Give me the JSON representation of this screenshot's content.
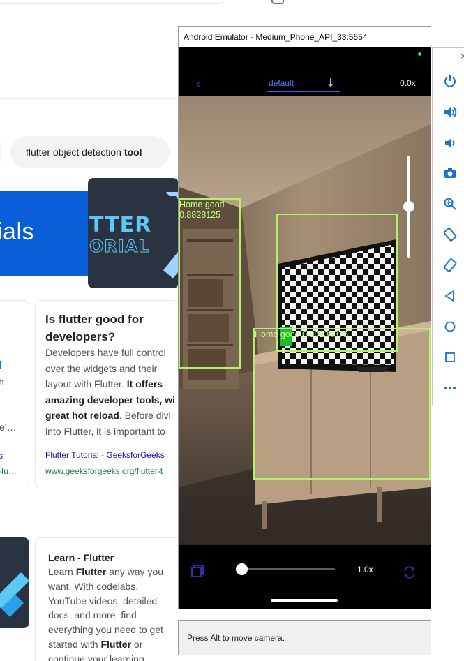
{
  "browser": {
    "search_chip": {
      "prefix": "flutter object detection ",
      "bold": "tool"
    },
    "banner": {
      "left_text": "ials",
      "logo_line1": "TTER",
      "logo_line2": "ORIAL"
    },
    "left_card_fragments": [
      "h",
      "le'…",
      "s",
      "-tu…"
    ],
    "result_card": {
      "title_line1": "Is flutter good for",
      "title_line2": "developers?",
      "line1": "Developers have full control",
      "line2": "over the widgets and their",
      "line3": "layout with Flutter.",
      "line3_bold": " It offers",
      "line4_bold": "amazing developer tools, wi",
      "line5_bold": "great hot reload",
      "line5": ". Before divi",
      "line6": "into Flutter, it is important to",
      "source": "Flutter Tutorial - GeeksforGeeks",
      "url": "www.geeksforgeeks.org/flutter-t"
    },
    "learn_card": {
      "title": "Learn - Flutter",
      "l1a": "Learn ",
      "l1b": "Flutter",
      "l1c": " any way you",
      "l2": "want. With codelabs,",
      "l3": "YouTube videos, detailed",
      "l4": "docs, and more, find",
      "l5": "everything you need to get",
      "l6a": "started with ",
      "l6b": "Flutter",
      "l6c": " or",
      "l7": "continue your learning"
    }
  },
  "emulator": {
    "window_title": "Android Emulator - Medium_Phone_API_33:5554",
    "app": {
      "tab_label": "default",
      "zoom_top": "0.0x",
      "zoom_bottom": "1.0x",
      "zoom_slider_fraction": 0.0,
      "exposure_slider_fraction": 0.5
    },
    "detections": [
      {
        "label": "Home good",
        "score": "0.8828125"
      },
      {
        "label": "Home good 0.90234375",
        "score": ""
      },
      {
        "label": "",
        "score": ""
      }
    ],
    "hint": "Press Alt to move camera.",
    "toolbar": [
      "power-icon",
      "volume-up-icon",
      "volume-down-icon",
      "camera-icon",
      "zoom-icon",
      "rotate-left-icon",
      "rotate-right-icon",
      "back-icon",
      "home-icon",
      "overview-icon",
      "more-icon"
    ]
  },
  "colors": {
    "detection_box": "#b4f06a",
    "accent": "#2f63ff",
    "emulator_bg": "#000000"
  }
}
